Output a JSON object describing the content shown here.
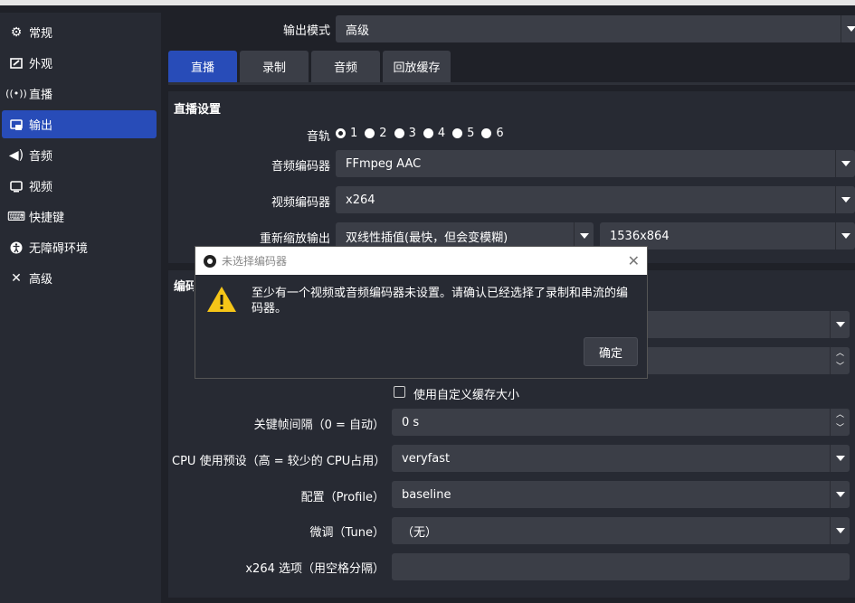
{
  "sidebar": {
    "items": [
      {
        "label": "常规",
        "icon": "gear-icon"
      },
      {
        "label": "外观",
        "icon": "paint-icon"
      },
      {
        "label": "直播",
        "icon": "broadcast-icon"
      },
      {
        "label": "输出",
        "icon": "output-icon"
      },
      {
        "label": "音频",
        "icon": "speaker-icon"
      },
      {
        "label": "视频",
        "icon": "monitor-icon"
      },
      {
        "label": "快捷键",
        "icon": "keyboard-icon"
      },
      {
        "label": "无障碍环境",
        "icon": "accessibility-icon"
      },
      {
        "label": "高级",
        "icon": "tools-icon"
      }
    ],
    "active_index": 3
  },
  "output_mode": {
    "label": "输出模式",
    "value": "高级"
  },
  "tabs": [
    "直播",
    "录制",
    "音频",
    "回放缓存"
  ],
  "stream_settings": {
    "title": "直播设置",
    "audio_track_label": "音轨",
    "tracks": [
      "1",
      "2",
      "3",
      "4",
      "5",
      "6"
    ],
    "audio_encoder_label": "音频编码器",
    "audio_encoder_value": "FFmpeg AAC",
    "video_encoder_label": "视频编码器",
    "video_encoder_value": "x264",
    "rescale_label": "重新缩放输出",
    "rescale_filter": "双线性插值(最快，但会变模糊)",
    "rescale_resolution": "1536x864"
  },
  "encoder_settings": {
    "title": "编码器设置",
    "custom_buffer_label": "使用自定义缓存大小",
    "keyframe_label": "关键帧间隔（0 = 自动）",
    "keyframe_value": "0 s",
    "cpu_preset_label": "CPU 使用预设（高 = 较少的 CPU占用）",
    "cpu_preset_value": "veryfast",
    "profile_label": "配置（Profile）",
    "profile_value": "baseline",
    "tune_label": "微调（Tune）",
    "tune_value": "（无）",
    "x264_opts_label": "x264 选项（用空格分隔）",
    "x264_opts_value": ""
  },
  "dialog": {
    "title": "未选择编码器",
    "message": "至少有一个视频或音频编码器未设置。请确认已经选择了录制和串流的编码器。",
    "ok_label": "确定"
  },
  "colors": {
    "accent": "#284cb8",
    "warning": "#f5c518"
  }
}
